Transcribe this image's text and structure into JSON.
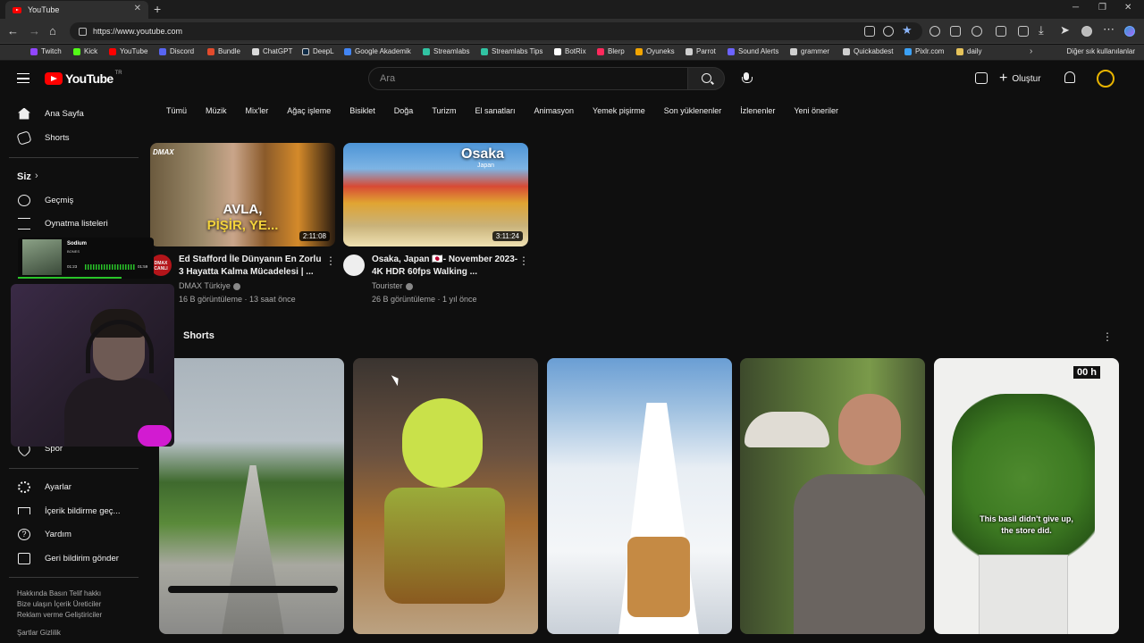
{
  "browser": {
    "tab_title": "YouTube",
    "tab_close": "✕",
    "new_tab": "+",
    "url": "https://www.youtube.com",
    "window_controls": [
      "─",
      "❐",
      "✕"
    ],
    "nav": {
      "back": "←",
      "forward": "→",
      "reload": "↻",
      "home": "⌂"
    },
    "bookmarks": [
      {
        "label": "Twitch",
        "color": "#9146ff"
      },
      {
        "label": "Kick",
        "color": "#53fc18"
      },
      {
        "label": "YouTube",
        "color": "#ff0000"
      },
      {
        "label": "Discord",
        "color": "#5865f2"
      },
      {
        "label": "Bundle",
        "color": "#e34b2c"
      },
      {
        "label": "ChatGPT",
        "color": "#d9d9d9"
      },
      {
        "label": "DeepL",
        "color": "#0f2b46"
      },
      {
        "label": "Google Akademik",
        "color": "#4285f4"
      },
      {
        "label": "Streamlabs",
        "color": "#31c3a2"
      },
      {
        "label": "Streamlabs Tips",
        "color": "#31c3a2"
      },
      {
        "label": "BotRix",
        "color": "#ffffff"
      },
      {
        "label": "Blerp",
        "color": "#fe295c"
      },
      {
        "label": "Oyuneks",
        "color": "#f2a500"
      },
      {
        "label": "Parrot",
        "color": "#cfcfcf"
      },
      {
        "label": "Sound Alerts",
        "color": "#6c63ff"
      },
      {
        "label": "grammer",
        "color": "#cfcfcf"
      },
      {
        "label": "Quickabdest",
        "color": "#cfcfcf"
      },
      {
        "label": "Pixlr.com",
        "color": "#3ba1f7"
      },
      {
        "label": "daily",
        "color": "#e6c35a"
      }
    ],
    "bookmarks_more": "›",
    "other_bookmarks": "Diğer sık kullanılanlar"
  },
  "youtube": {
    "logo_text": "YouTube",
    "logo_region": "TR",
    "search_placeholder": "Ara",
    "create_label": "Oluştur",
    "create_plus": "+",
    "chips": [
      "Tümü",
      "Müzik",
      "Mix'ler",
      "Ağaç işleme",
      "Bisiklet",
      "Doğa",
      "Turizm",
      "El sanatları",
      "Animasyon",
      "Yemek pişirme",
      "Son yüklenenler",
      "İzlenenler",
      "Yeni öneriler"
    ],
    "sidebar": {
      "home": "Ana Sayfa",
      "shorts": "Shorts",
      "you": "Siz",
      "you_chevron": "›",
      "history": "Geçmiş",
      "playlists": "Oynatma listeleri",
      "sports": "Spor",
      "settings": "Ayarlar",
      "report": "İçerik bildirme geç...",
      "help": "Yardım",
      "feedback": "Geri bildirim gönder",
      "footer_1": "Hakkında   Basın   Telif hakkı",
      "footer_2": "Bize ulaşın   İçerik Üreticiler",
      "footer_3": "Reklam verme   Geliştiriciler",
      "footer_4": "Şartlar   Gizlilik"
    },
    "videos": [
      {
        "thumb_text_1": "AVLA,",
        "thumb_text_2": "PİŞİR, YE...",
        "thumb_logo": "DMAX",
        "duration": "2:11:08",
        "title": "Ed Stafford İle Dünyanın En Zorlu 3 Hayatta Kalma Mücadelesi | ...",
        "channel": "DMAX Türkiye",
        "meta": "16 B görüntüleme · 13 saat önce",
        "avatar_text": "DMAX CANLI",
        "more": "⋮"
      },
      {
        "thumb_text_1": "Osaka",
        "thumb_text_2": "Japan",
        "duration": "3:11:24",
        "title": "Osaka, Japan 🇯🇵- November 2023- 4K HDR 60fps Walking ...",
        "channel": "Tourister",
        "meta": "26 B görüntüleme · 1 yıl önce",
        "more": "⋮"
      }
    ],
    "shorts_header": "Shorts",
    "shorts_more": "⋮",
    "shorts": [
      {
        "kind": "bike-stairs"
      },
      {
        "kind": "pistachio-dessert"
      },
      {
        "kind": "snow-ski"
      },
      {
        "kind": "mushroom-forest"
      },
      {
        "kind": "basil-plant",
        "badge": "00 h",
        "caption_1": "This basil didn't give up,",
        "caption_2": "the store did."
      }
    ]
  },
  "overlay": {
    "song": "Sodium",
    "artist": "BONES",
    "time_current": "01:23",
    "time_total": "01:59"
  }
}
